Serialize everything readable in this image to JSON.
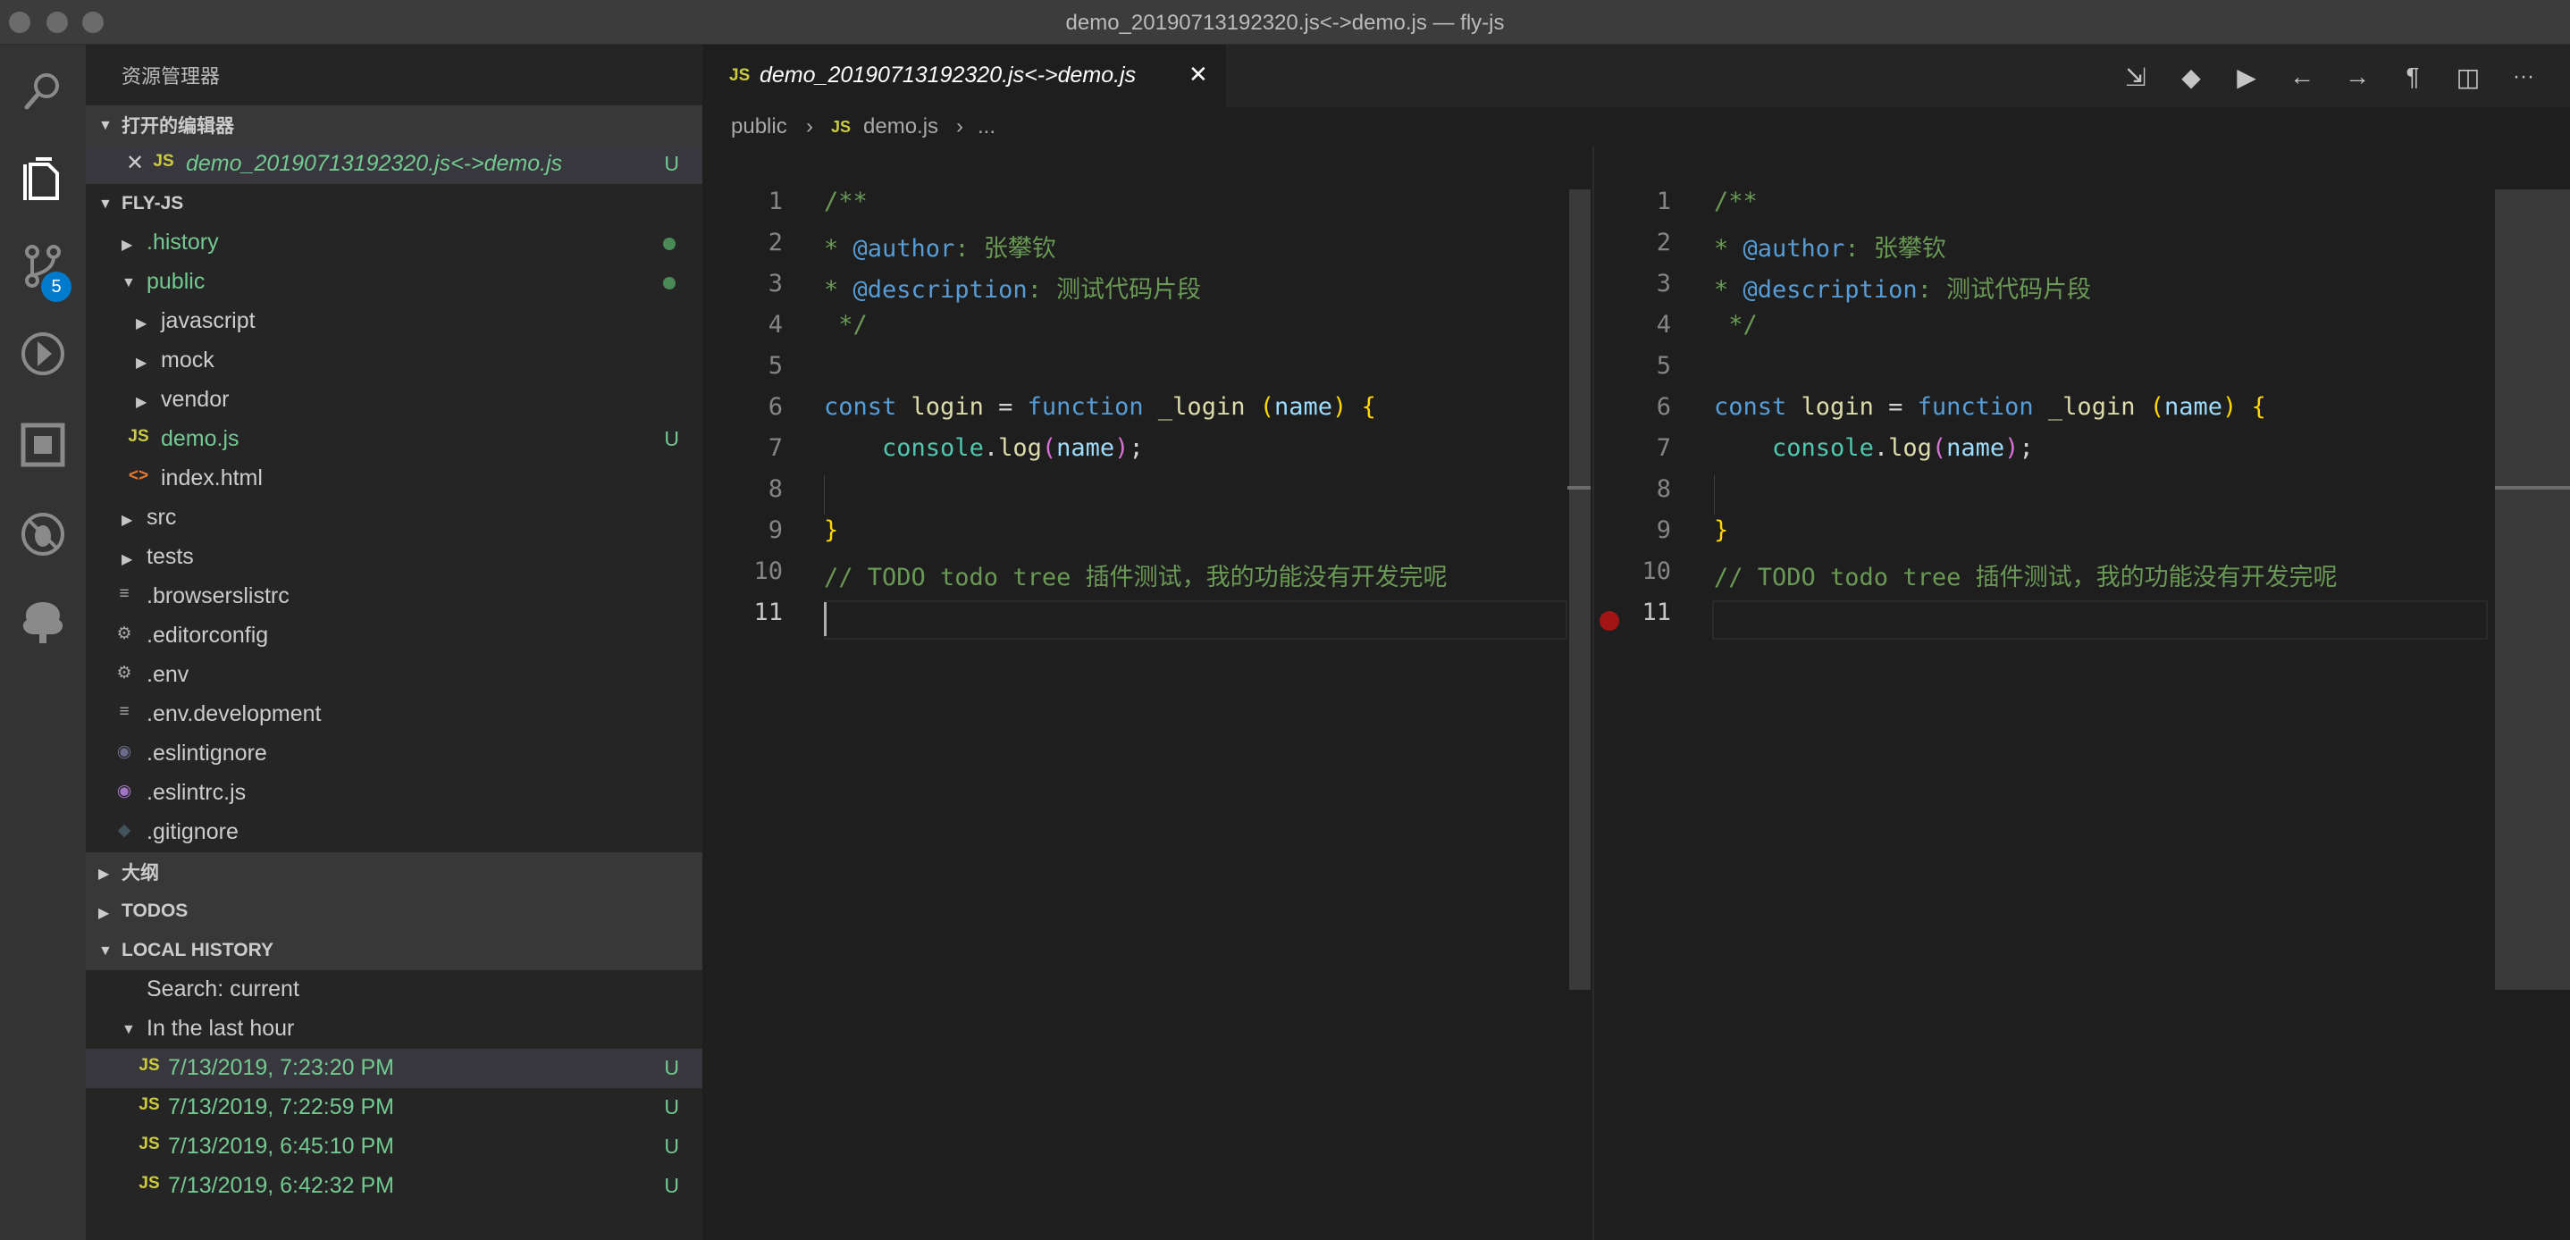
{
  "window": {
    "title": "demo_20190713192320.js<->demo.js — fly-js"
  },
  "activity_bar": {
    "items": [
      {
        "name": "search-icon"
      },
      {
        "name": "files-icon"
      },
      {
        "name": "source-control-icon",
        "badge": "5"
      },
      {
        "name": "debug-icon"
      },
      {
        "name": "extensions-icon"
      },
      {
        "name": "no-bug-icon"
      },
      {
        "name": "tree-icon"
      }
    ]
  },
  "sidebar": {
    "title": "资源管理器",
    "open_editors": {
      "header": "打开的编辑器",
      "items": [
        {
          "close": "✕",
          "icon": "JS",
          "label": "demo_20190713192320.js<->demo.js",
          "status": "U"
        }
      ]
    },
    "project": {
      "header": "FLY-JS",
      "items": [
        {
          "label": ".history",
          "type": "folder",
          "twisty": "▶"
        },
        {
          "label": "public",
          "type": "folder",
          "twisty": "▼"
        },
        {
          "label": "javascript",
          "type": "folder",
          "twisty": "▶"
        },
        {
          "label": "mock",
          "type": "folder",
          "twisty": "▶"
        },
        {
          "label": "vendor",
          "type": "folder",
          "twisty": "▶"
        },
        {
          "label": "demo.js",
          "icon": "JS",
          "status": "U"
        },
        {
          "label": "index.html",
          "icon": "<>"
        },
        {
          "label": "src",
          "type": "folder",
          "twisty": "▶"
        },
        {
          "label": "tests",
          "type": "folder",
          "twisty": "▶"
        },
        {
          "label": ".browserslistrc",
          "icon": "≡"
        },
        {
          "label": ".editorconfig",
          "icon": "⚙"
        },
        {
          "label": ".env",
          "icon": "⚙"
        },
        {
          "label": ".env.development",
          "icon": "≡"
        },
        {
          "label": ".eslintignore",
          "icon": "◉"
        },
        {
          "label": ".eslintrc.js",
          "icon": "◉"
        },
        {
          "label": ".gitignore",
          "icon": "◆"
        }
      ]
    },
    "outline": {
      "header": "大纲"
    },
    "todos": {
      "header": "TODOS"
    },
    "local_history": {
      "header": "LOCAL HISTORY",
      "search": "Search: current",
      "group": "In the last hour",
      "entries": [
        {
          "icon": "JS",
          "label": "7/13/2019, 7:23:20 PM",
          "status": "U"
        },
        {
          "icon": "JS",
          "label": "7/13/2019, 7:22:59 PM",
          "status": "U"
        },
        {
          "icon": "JS",
          "label": "7/13/2019, 6:45:10 PM",
          "status": "U"
        },
        {
          "icon": "JS",
          "label": "7/13/2019, 6:42:32 PM",
          "status": "U"
        }
      ]
    }
  },
  "editor": {
    "tab": {
      "icon": "JS",
      "label": "demo_20190713192320.js<->demo.js",
      "close": "✕"
    },
    "breadcrumb": {
      "folder": "public",
      "sep": "›",
      "icon": "JS",
      "file": "demo.js",
      "more": "..."
    },
    "toolbar": [
      {
        "name": "open-file-icon",
        "glyph": "⇲"
      },
      {
        "name": "git-icon",
        "glyph": "◆"
      },
      {
        "name": "run-icon",
        "glyph": "▶"
      },
      {
        "name": "arrow-left-icon",
        "glyph": "←"
      },
      {
        "name": "arrow-right-icon",
        "glyph": "→"
      },
      {
        "name": "whitespace-icon",
        "glyph": "¶"
      },
      {
        "name": "split-editor-icon",
        "glyph": "◫"
      },
      {
        "name": "more-icon",
        "glyph": "···"
      }
    ],
    "line_numbers": [
      "1",
      "2",
      "3",
      "4",
      "5",
      "6",
      "7",
      "8",
      "9",
      "10",
      "11"
    ],
    "code": {
      "l1": "/**",
      "l2_star": "* ",
      "l2_tag": "@author",
      "l2_text": ": 张攀钦",
      "l3_star": "* ",
      "l3_tag": "@description",
      "l3_text": ": 测试代码片段",
      "l4": " */",
      "l6_const": "const",
      "l6_login": "login",
      "l6_eq": " = ",
      "l6_function": "function",
      "l6_name": "_login",
      "l6_po": "(",
      "l6_param": "name",
      "l6_pc": ")",
      "l6_brace": "{",
      "l7_console": "console",
      "l7_dot": ".",
      "l7_log": "log",
      "l7_po": "(",
      "l7_arg": "name",
      "l7_pc": ")",
      "l7_semi": ";",
      "l9": "}",
      "l10": "// TODO todo tree 插件测试，我的功能没有开发完呢"
    }
  }
}
